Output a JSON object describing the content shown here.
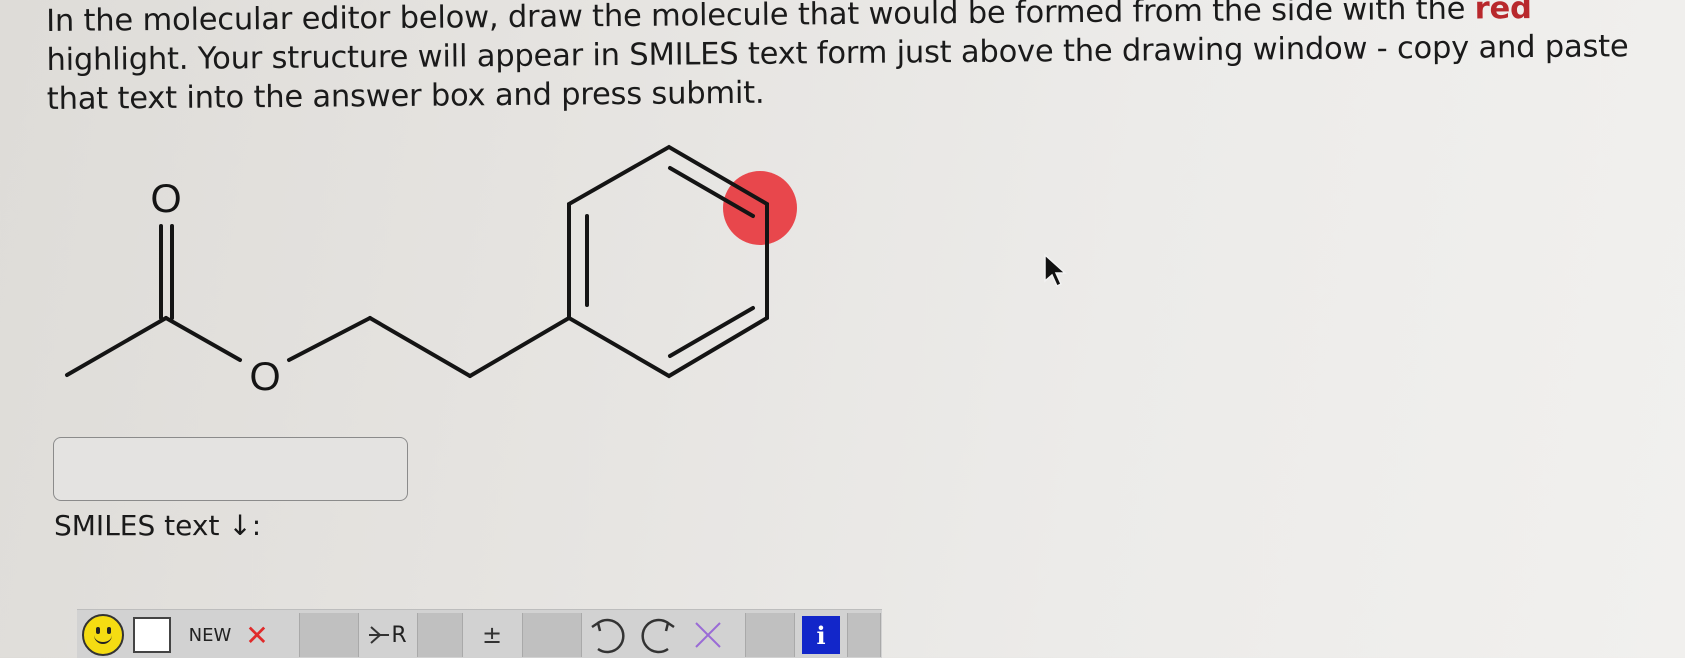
{
  "instructions": {
    "part1": "In the molecular editor below, draw the molecule that would be formed from the side with the ",
    "highlight_word": "red",
    "part2": " highlight. Your structure will appear in SMILES text form just above the drawing window - copy and paste that text into the answer box and press submit."
  },
  "molecule": {
    "atom_labels": {
      "carbonyl_oxygen": "O",
      "ester_oxygen": "O"
    },
    "highlight_color": "#e8474c"
  },
  "answer_box": {
    "value": "",
    "placeholder": ""
  },
  "smiles_label": "SMILES text ↓:",
  "toolbar": {
    "new_label": "NEW",
    "delete_glyph": "✕",
    "rgroup_label": "R",
    "charge_glyph": "±",
    "info_label": "i"
  },
  "colors": {
    "highlight_red": "#b8282c",
    "info_blue": "#1226c9",
    "smiley_yellow": "#f5dc12",
    "delete_red": "#e02a2a",
    "erase_purple": "#9a6bd6"
  }
}
